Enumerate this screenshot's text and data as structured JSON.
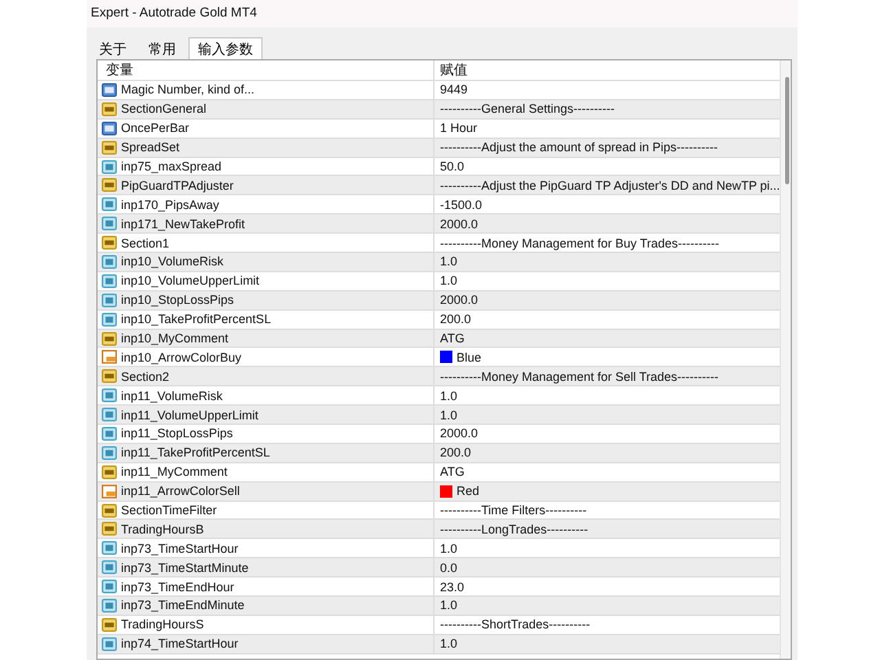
{
  "window": {
    "title": "Expert - Autotrade Gold MT4"
  },
  "tabs": [
    {
      "label": "关于",
      "selected": false
    },
    {
      "label": "常用",
      "selected": false
    },
    {
      "label": "输入参数",
      "selected": true
    }
  ],
  "table": {
    "columns": [
      "变量",
      "赋值"
    ],
    "rows": [
      {
        "kind": "int",
        "name": "Magic Number, kind of...",
        "value": "9449"
      },
      {
        "kind": "string",
        "name": "SectionGeneral",
        "value": "----------General Settings----------"
      },
      {
        "kind": "int",
        "name": "OncePerBar",
        "value": "1 Hour"
      },
      {
        "kind": "string",
        "name": "SpreadSet",
        "value": "----------Adjust the amount of spread in Pips----------"
      },
      {
        "kind": "double",
        "name": "inp75_maxSpread",
        "value": "50.0"
      },
      {
        "kind": "string",
        "name": "PipGuardTPAdjuster",
        "value": "----------Adjust the PipGuard TP Adjuster's DD and NewTP pi..."
      },
      {
        "kind": "double",
        "name": "inp170_PipsAway",
        "value": "-1500.0"
      },
      {
        "kind": "double",
        "name": "inp171_NewTakeProfit",
        "value": "2000.0"
      },
      {
        "kind": "string",
        "name": "Section1",
        "value": "----------Money Management for Buy Trades----------"
      },
      {
        "kind": "double",
        "name": "inp10_VolumeRisk",
        "value": "1.0"
      },
      {
        "kind": "double",
        "name": "inp10_VolumeUpperLimit",
        "value": "1.0"
      },
      {
        "kind": "double",
        "name": "inp10_StopLossPips",
        "value": "2000.0"
      },
      {
        "kind": "double",
        "name": "inp10_TakeProfitPercentSL",
        "value": "200.0"
      },
      {
        "kind": "string",
        "name": "inp10_MyComment",
        "value": "ATG"
      },
      {
        "kind": "color",
        "name": "inp10_ArrowColorBuy",
        "value": "Blue",
        "color": "#0000ff"
      },
      {
        "kind": "string",
        "name": "Section2",
        "value": "----------Money Management for Sell Trades----------"
      },
      {
        "kind": "double",
        "name": "inp11_VolumeRisk",
        "value": "1.0"
      },
      {
        "kind": "double",
        "name": "inp11_VolumeUpperLimit",
        "value": "1.0"
      },
      {
        "kind": "double",
        "name": "inp11_StopLossPips",
        "value": "2000.0"
      },
      {
        "kind": "double",
        "name": "inp11_TakeProfitPercentSL",
        "value": "200.0"
      },
      {
        "kind": "string",
        "name": "inp11_MyComment",
        "value": "ATG"
      },
      {
        "kind": "color",
        "name": "inp11_ArrowColorSell",
        "value": "Red",
        "color": "#ff0000"
      },
      {
        "kind": "string",
        "name": "SectionTimeFilter",
        "value": "----------Time Filters----------"
      },
      {
        "kind": "string",
        "name": "TradingHoursB",
        "value": "----------LongTrades----------"
      },
      {
        "kind": "double",
        "name": "inp73_TimeStartHour",
        "value": "1.0"
      },
      {
        "kind": "double",
        "name": "inp73_TimeStartMinute",
        "value": "0.0"
      },
      {
        "kind": "double",
        "name": "inp73_TimeEndHour",
        "value": "23.0"
      },
      {
        "kind": "double",
        "name": "inp73_TimeEndMinute",
        "value": "1.0"
      },
      {
        "kind": "string",
        "name": "TradingHoursS",
        "value": "----------ShortTrades----------"
      },
      {
        "kind": "double",
        "name": "inp74_TimeStartHour",
        "value": "1.0"
      }
    ]
  }
}
